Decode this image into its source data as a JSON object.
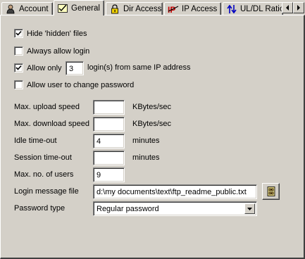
{
  "tabs": [
    {
      "label": "Account",
      "icon": "user-icon",
      "active": false
    },
    {
      "label": "General",
      "icon": "checklist-icon",
      "active": true
    },
    {
      "label": "Dir Access",
      "icon": "lock-icon",
      "active": false
    },
    {
      "label": "IP Access",
      "icon": "ip-icon",
      "active": false
    },
    {
      "label": "UL/DL Ratio",
      "icon": "updown-arrows-icon",
      "active": false
    }
  ],
  "options": {
    "hide_hidden": {
      "label": "Hide 'hidden' files",
      "checked": true
    },
    "always_login": {
      "label": "Always allow login",
      "checked": false
    },
    "allow_only": {
      "label": "Allow only",
      "checked": true,
      "value": "3",
      "suffix": "login(s) from same IP address"
    },
    "change_password": {
      "label": "Allow user to change password",
      "checked": false
    }
  },
  "fields": {
    "upload_speed": {
      "label": "Max. upload speed",
      "value": "",
      "unit": "KBytes/sec"
    },
    "download_speed": {
      "label": "Max. download speed",
      "value": "",
      "unit": "KBytes/sec"
    },
    "idle_timeout": {
      "label": "Idle time-out",
      "value": "4",
      "unit": "minutes"
    },
    "session_timeout": {
      "label": "Session time-out",
      "value": "",
      "unit": "minutes"
    },
    "max_users": {
      "label": "Max. no. of users",
      "value": "9"
    },
    "login_message": {
      "label": "Login message file",
      "value": "d:\\my documents\\text\\ftp_readme_public.txt"
    },
    "password_type": {
      "label": "Password type",
      "value": "Regular password"
    }
  },
  "colors": {
    "face": "#d4d0c8",
    "window": "#ffffff",
    "checkmark": "#000000"
  }
}
